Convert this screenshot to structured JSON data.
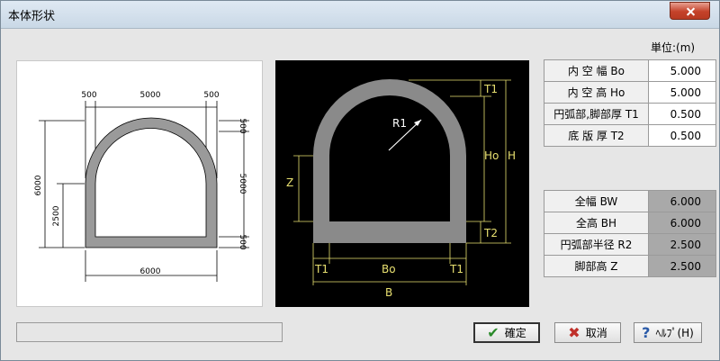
{
  "title": "本体形状",
  "unit_label": "単位:(m)",
  "inputs": [
    {
      "label": "内 空 幅 Bo",
      "value": "5.000"
    },
    {
      "label": "内 空 高 Ho",
      "value": "5.000"
    },
    {
      "label": "円弧部,脚部厚 T1",
      "value": "0.500"
    },
    {
      "label": "底 版 厚 T2",
      "value": "0.500"
    }
  ],
  "results": [
    {
      "label": "全幅 BW",
      "value": "6.000"
    },
    {
      "label": "全高 BH",
      "value": "6.000"
    },
    {
      "label": "円弧部半径 R2",
      "value": "2.500"
    },
    {
      "label": "脚部高 Z",
      "value": "2.500"
    }
  ],
  "buttons": {
    "ok": "確定",
    "cancel": "取消",
    "help": "ﾍﾙﾌﾟ(H)"
  },
  "drawing_left": {
    "top_left": "500",
    "top_mid": "5000",
    "top_right": "500",
    "left_total": "6000",
    "left_sub": "2500",
    "right_top": "500",
    "right_mid": "5000",
    "right_bottom": "500",
    "bottom_total": "6000"
  },
  "drawing_right": {
    "t1_top": "T1",
    "r1": "R1",
    "ho": "Ho",
    "h": "H",
    "z": "Z",
    "t2": "T2",
    "t1_left": "T1",
    "bo": "Bo",
    "t1_right": "T1",
    "b": "B"
  },
  "colors": {
    "dim_yellow": "#e8e070",
    "section_gray": "#8a8a8a",
    "readonly_cell": "#a9a9a9"
  }
}
